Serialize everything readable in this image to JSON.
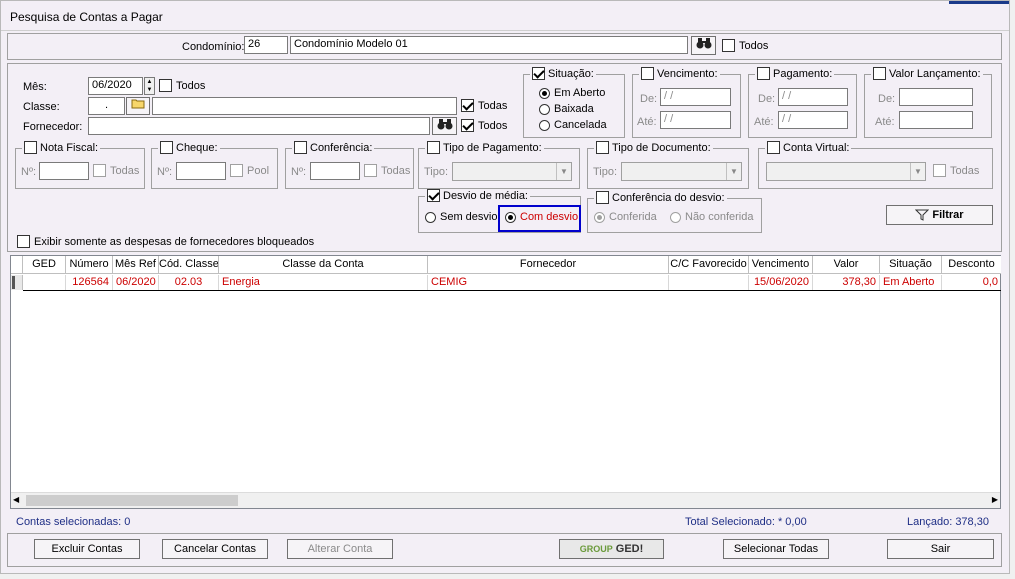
{
  "window": {
    "title": "Pesquisa de Contas a Pagar"
  },
  "condominio": {
    "label": "Condomínio:",
    "code": "26",
    "name": "Condomínio Modelo 01",
    "todos": "Todos"
  },
  "filters": {
    "mes_label": "Mês:",
    "mes_value": "06/2020",
    "mes_todos": "Todos",
    "classe_label": "Classe:",
    "classe_value": ".",
    "classe_todas": "Todas",
    "fornecedor_label": "Fornecedor:",
    "fornecedor_todos": "Todos",
    "situacao": {
      "title": "Situação:",
      "em_aberto": "Em Aberto",
      "baixada": "Baixada",
      "cancelada": "Cancelada"
    },
    "vencimento": {
      "title": "Vencimento:",
      "de": "De:",
      "ate": "Até:",
      "de_value": " / /",
      "ate_value": " / /"
    },
    "pagamento": {
      "title": "Pagamento:",
      "de": "De:",
      "ate": "Até:",
      "de_value": " / /",
      "ate_value": " / /"
    },
    "valor": {
      "title": "Valor Lançamento:",
      "de": "De:",
      "ate": "Até:"
    },
    "nota_fiscal": {
      "title": "Nota Fiscal:",
      "no": "Nº:",
      "todas": "Todas"
    },
    "cheque": {
      "title": "Cheque:",
      "no": "Nº:",
      "pool": "Pool"
    },
    "conferencia": {
      "title": "Conferência:",
      "no": "Nº:",
      "todas": "Todas"
    },
    "tipo_pagamento": {
      "title": "Tipo de Pagamento:",
      "tipo": "Tipo:"
    },
    "tipo_documento": {
      "title": "Tipo de Documento:",
      "tipo": "Tipo:"
    },
    "conta_virtual": {
      "title": "Conta Virtual:",
      "todas": "Todas"
    },
    "desvio": {
      "title": "Desvio de média:",
      "sem": "Sem desvio",
      "com": "Com desvio"
    },
    "conf_desvio": {
      "title": "Conferência do desvio:",
      "conferida": "Conferida",
      "nao": "Não conferida"
    },
    "filtrar": "Filtrar",
    "bloqueados": "Exibir somente as despesas de fornecedores bloqueados"
  },
  "table": {
    "headers": [
      "GED",
      "Número",
      "Mês Ref",
      "Cód. Classe",
      "Classe da Conta",
      "Fornecedor",
      "C/C Favorecido",
      "Vencimento",
      "Valor",
      "Situação",
      "Desconto"
    ],
    "rows": [
      {
        "ged": "",
        "numero": "126564",
        "mes_ref": "06/2020",
        "cod_classe": "02.03",
        "classe": "Energia",
        "fornecedor": "CEMIG",
        "cc": "",
        "vencimento": "15/06/2020",
        "valor": "378,30",
        "situacao": "Em Aberto",
        "desconto": "0,0"
      }
    ]
  },
  "status": {
    "selecionadas": "Contas selecionadas: 0",
    "total": "Total Selecionado: * 0,00",
    "lancado": "Lançado: 378,30"
  },
  "buttons": {
    "excluir": "Excluir Contas",
    "cancelar": "Cancelar Contas",
    "alterar": "Alterar Conta",
    "ged_brand": "GROUP",
    "ged": "GED!",
    "selecionar": "Selecionar Todas",
    "sair": "Sair"
  },
  "colors": {
    "accent_red": "#cc0000",
    "focus_blue": "#0000cc",
    "status_blue": "#1f2f86"
  }
}
